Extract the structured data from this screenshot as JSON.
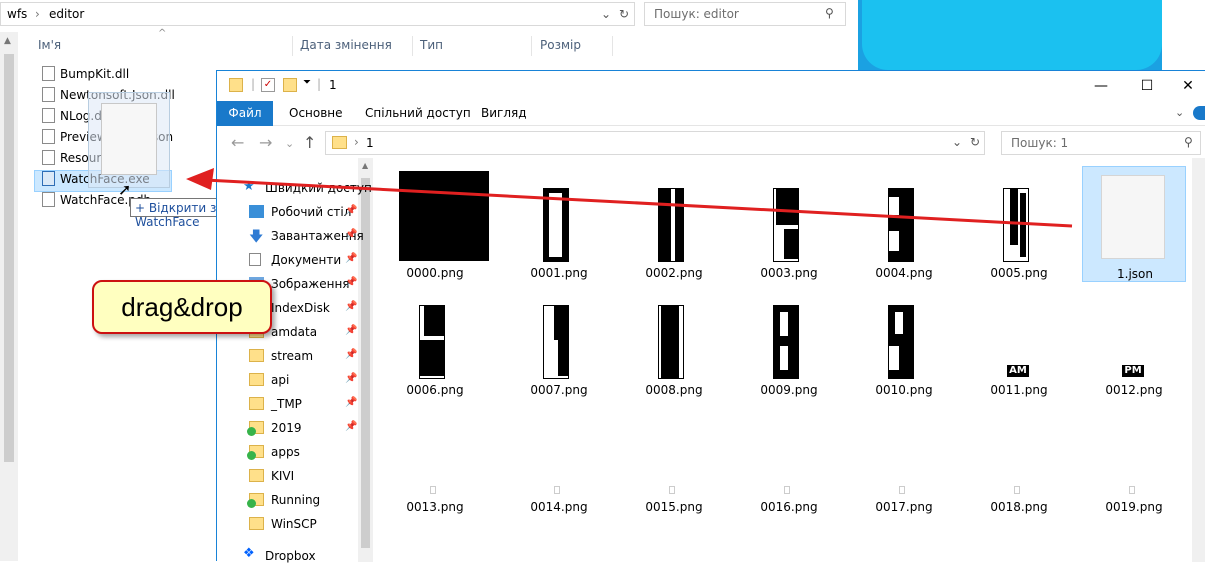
{
  "back_window": {
    "breadcrumb": [
      "wfs",
      "editor"
    ],
    "search_placeholder": "Пошук: editor",
    "columns": [
      "Ім'я",
      "Дата змінення",
      "Тип",
      "Розмір"
    ],
    "files": [
      "BumpKit.dll",
      "Newtonsoft.Json.dll",
      "NLog.dll",
      "PreviewStates.json",
      "Resources.dll",
      "WatchFace.exe",
      "WatchFace.pdb"
    ],
    "selected_file": "WatchFace.exe",
    "drop_tooltip": "+ Відкрити за допомогою WatchFace"
  },
  "front_window": {
    "title": "1",
    "ribbon_tabs": [
      "Файл",
      "Основне",
      "Спільний доступ",
      "Вигляд"
    ],
    "address": "1",
    "search_placeholder": "Пошук: 1",
    "nav_items": [
      {
        "label": "Швидкий доступ",
        "icon": "star-icon"
      },
      {
        "label": "Робочий стіл",
        "icon": "desktop-icon"
      },
      {
        "label": "Завантаження",
        "icon": "download-icon"
      },
      {
        "label": "Документи",
        "icon": "document-icon"
      },
      {
        "label": "Зображення",
        "icon": "pictures-icon"
      },
      {
        "label": "IndexDisk",
        "icon": "folder-icon"
      },
      {
        "label": "amdata",
        "icon": "folder-icon"
      },
      {
        "label": "stream",
        "icon": "folder-icon"
      },
      {
        "label": "api",
        "icon": "folder-icon"
      },
      {
        "label": "_TMP",
        "icon": "folder-icon"
      },
      {
        "label": "2019",
        "icon": "synced-folder-icon"
      },
      {
        "label": "apps",
        "icon": "synced-folder-icon"
      },
      {
        "label": "KIVI",
        "icon": "folder-icon"
      },
      {
        "label": "Running",
        "icon": "synced-folder-icon"
      },
      {
        "label": "WinSCP",
        "icon": "folder-icon"
      },
      {
        "label": "Dropbox",
        "icon": "dropbox-icon"
      }
    ],
    "files": [
      "0000.png",
      "0001.png",
      "0002.png",
      "0003.png",
      "0004.png",
      "0005.png",
      "1.json",
      "0006.png",
      "0007.png",
      "0008.png",
      "0009.png",
      "0010.png",
      "0011.png",
      "0012.png",
      "0013.png",
      "0014.png",
      "0015.png",
      "0016.png",
      "0017.png",
      "0018.png",
      "0019.png"
    ],
    "selected_file": "1.json",
    "thumb_text": {
      "am": "AM",
      "pm": "PM"
    }
  },
  "callout": {
    "text": "drag&drop"
  },
  "colors": {
    "accent": "#1979ca",
    "arrow": "#e02020",
    "callout_bg": "#ffffc0",
    "selection": "#cce8ff"
  }
}
